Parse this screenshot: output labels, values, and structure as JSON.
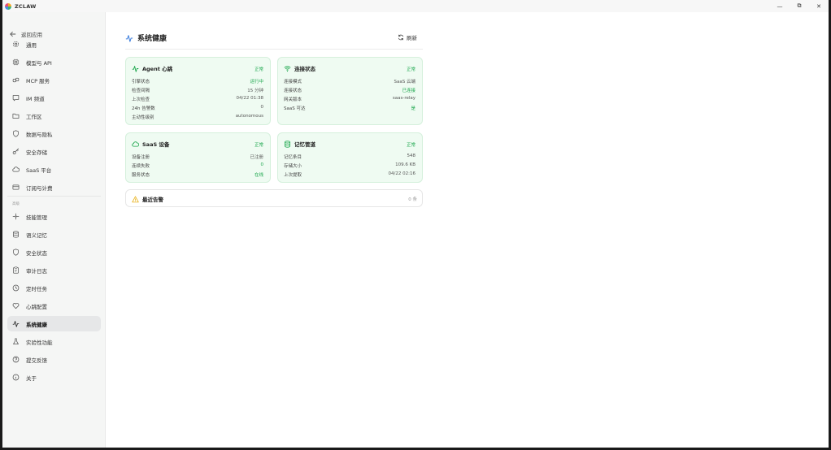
{
  "app": {
    "title": "ZCLAW"
  },
  "window_controls": {
    "minimize": "—",
    "restore": "⧉",
    "close": "✕"
  },
  "sidebar": {
    "back_label": "返回应用",
    "items_top": [
      {
        "label": "通用",
        "icon": "gear-icon"
      },
      {
        "label": "模型与 API",
        "icon": "chip-icon"
      },
      {
        "label": "MCP 服务",
        "icon": "plug-icon"
      },
      {
        "label": "IM 频道",
        "icon": "chat-icon"
      },
      {
        "label": "工作区",
        "icon": "folder-icon"
      },
      {
        "label": "数据与隐私",
        "icon": "shield-icon"
      },
      {
        "label": "安全存储",
        "icon": "key-icon"
      },
      {
        "label": "SaaS 平台",
        "icon": "cloud-icon"
      },
      {
        "label": "订阅与计费",
        "icon": "card-icon"
      }
    ],
    "section_label": "高级",
    "items_advanced": [
      {
        "label": "技能管理",
        "icon": "sparkle-icon"
      },
      {
        "label": "语义记忆",
        "icon": "database-icon"
      },
      {
        "label": "安全状态",
        "icon": "shield-icon"
      },
      {
        "label": "审计日志",
        "icon": "clipboard-icon"
      },
      {
        "label": "定时任务",
        "icon": "clock-icon"
      },
      {
        "label": "心跳配置",
        "icon": "heart-icon"
      },
      {
        "label": "系统健康",
        "icon": "pulse-icon",
        "active": true
      },
      {
        "label": "实验性功能",
        "icon": "flask-icon"
      },
      {
        "label": "提交反馈",
        "icon": "help-icon"
      },
      {
        "label": "关于",
        "icon": "info-icon"
      }
    ]
  },
  "main": {
    "title": "系统健康",
    "refresh_label": "刷新",
    "cards": {
      "agent": {
        "title": "Agent 心跳",
        "status": "正常",
        "rows": [
          {
            "k": "引擎状态",
            "v": "运行中",
            "green": true
          },
          {
            "k": "检查间隔",
            "v": "15 分钟"
          },
          {
            "k": "上次检查",
            "v": "04/22 01:38"
          },
          {
            "k": "24h 告警数",
            "v": "0"
          },
          {
            "k": "主动性级别",
            "v": "autonomous"
          }
        ]
      },
      "connection": {
        "title": "连接状态",
        "status": "正常",
        "rows": [
          {
            "k": "连接模式",
            "v": "SaaS 云端"
          },
          {
            "k": "连接状态",
            "v": "已连接",
            "green": true
          },
          {
            "k": "网关版本",
            "v": "saas-relay"
          },
          {
            "k": "SaaS 可达",
            "v": "是",
            "green": true
          }
        ]
      },
      "saas": {
        "title": "SaaS 设备",
        "status": "正常",
        "rows": [
          {
            "k": "设备注册",
            "v": "已注册"
          },
          {
            "k": "连续失败",
            "v": "0",
            "green": true
          },
          {
            "k": "服务状态",
            "v": "在线",
            "green": true
          }
        ]
      },
      "memory": {
        "title": "记忆管道",
        "status": "正常",
        "rows": [
          {
            "k": "记忆条目",
            "v": "548"
          },
          {
            "k": "存储大小",
            "v": "109.6 KB"
          },
          {
            "k": "上次提取",
            "v": "04/22 02:16"
          }
        ]
      }
    },
    "alerts": {
      "title": "最近告警",
      "count": "0 条"
    }
  },
  "colors": {
    "accent_green": "#1aa64b",
    "card_bg": "#effbf2",
    "card_border": "#d5f0dc",
    "alert_yellow": "#e8b21c",
    "primary_blue": "#3b7ddd"
  }
}
